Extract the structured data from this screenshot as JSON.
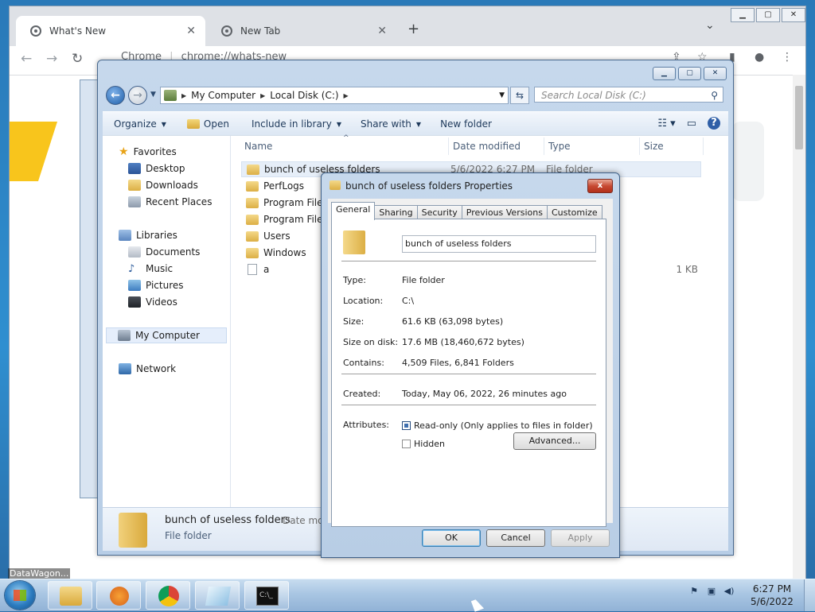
{
  "browser": {
    "tabs": [
      {
        "label": "What's New",
        "active": true
      },
      {
        "label": "New Tab",
        "active": false
      }
    ],
    "new_tab_symbol": "+",
    "omnibox": {
      "site": "Chrome",
      "url": "chrome://whats-new"
    },
    "icons": [
      "back-icon",
      "forward-icon",
      "reload-icon",
      "share-icon",
      "star-icon",
      "sidepanel-icon",
      "profile-icon",
      "menu-icon"
    ]
  },
  "explorer": {
    "breadcrumb": [
      "My Computer",
      "Local Disk (C:)"
    ],
    "search_placeholder": "Search Local Disk (C:)",
    "commands": [
      "Organize",
      "Open",
      "Include in library",
      "Share with",
      "New folder"
    ],
    "nav": {
      "favorites_label": "Favorites",
      "favorites": [
        "Desktop",
        "Downloads",
        "Recent Places"
      ],
      "libraries_label": "Libraries",
      "libraries": [
        "Documents",
        "Music",
        "Pictures",
        "Videos"
      ],
      "computer": "My Computer",
      "network": "Network"
    },
    "columns": {
      "name": "Name",
      "date": "Date modified",
      "type": "Type",
      "size": "Size"
    },
    "files": [
      {
        "name": "bunch of useless folders",
        "date": "5/6/2022 6:27 PM",
        "type": "File folder",
        "size": "",
        "kind": "folder",
        "selected": true
      },
      {
        "name": "PerfLogs",
        "date": "",
        "type": "",
        "size": "",
        "kind": "folder",
        "selected": false
      },
      {
        "name": "Program Files",
        "date": "",
        "type": "",
        "size": "",
        "kind": "folder",
        "selected": false
      },
      {
        "name": "Program Files",
        "date": "",
        "type": "",
        "size": "",
        "kind": "folder",
        "selected": false
      },
      {
        "name": "Users",
        "date": "",
        "type": "",
        "size": "",
        "kind": "folder",
        "selected": false
      },
      {
        "name": "Windows",
        "date": "",
        "type": "",
        "size": "",
        "kind": "folder",
        "selected": false
      },
      {
        "name": "a",
        "date": "",
        "type": "",
        "size": "1 KB",
        "kind": "file",
        "selected": false
      }
    ],
    "details": {
      "name": "bunch of useless folders",
      "date_label": "Date mo",
      "type": "File folder"
    }
  },
  "properties": {
    "title": "bunch of useless folders Properties",
    "close": "x",
    "tabs": [
      "General",
      "Sharing",
      "Security",
      "Previous Versions",
      "Customize"
    ],
    "folder_name": "bunch of useless folders",
    "fields": {
      "type_label": "Type:",
      "type": "File folder",
      "location_label": "Location:",
      "location": "C:\\",
      "size_label": "Size:",
      "size": "61.6 KB (63,098 bytes)",
      "size_on_disk_label": "Size on disk:",
      "size_on_disk": "17.6 MB (18,460,672 bytes)",
      "contains_label": "Contains:",
      "contains": "4,509 Files, 6,841 Folders",
      "created_label": "Created:",
      "created": "Today, May 06, 2022, 26 minutes ago",
      "attributes_label": "Attributes:",
      "readonly": "Read-only (Only applies to files in folder)",
      "readonly_checked": true,
      "hidden": "Hidden",
      "hidden_checked": false
    },
    "advanced": "Advanced...",
    "buttons": {
      "ok": "OK",
      "cancel": "Cancel",
      "apply": "Apply"
    }
  },
  "taskbar": {
    "clock_time": "6:27 PM",
    "clock_date": "5/6/2022",
    "watermark": "DataWagon..."
  }
}
